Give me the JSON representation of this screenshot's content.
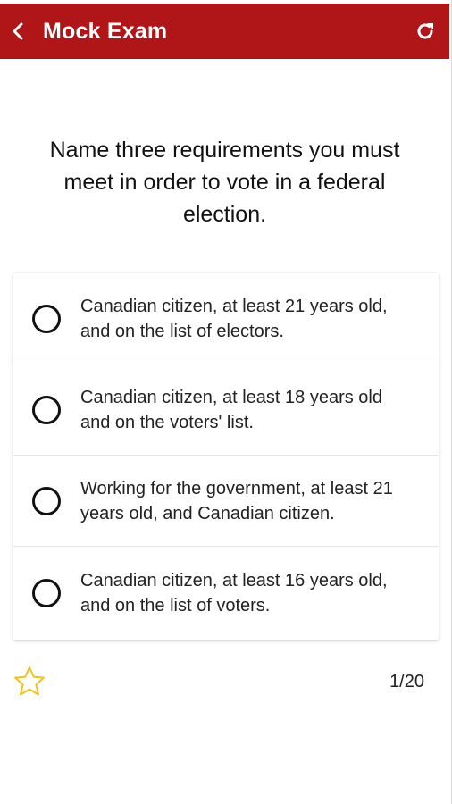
{
  "header": {
    "title": "Mock Exam",
    "back_icon": "chevron-left-icon",
    "refresh_icon": "refresh-icon",
    "background_color": "#b01518"
  },
  "question": {
    "text": "Name three requirements you must meet in order to vote in a federal election."
  },
  "options": [
    {
      "label": "Canadian citizen, at least 21 years old, and on the list of electors."
    },
    {
      "label": "Canadian citizen, at least 18 years old and on the voters' list."
    },
    {
      "label": "Working for the government, at least 21 years old, and Canadian citizen."
    },
    {
      "label": "Canadian citizen, at least 16 years old, and on the list of voters."
    }
  ],
  "footer": {
    "favorite_icon": "star-outline-icon",
    "star_color": "#f2c21b",
    "progress": "1/20"
  }
}
